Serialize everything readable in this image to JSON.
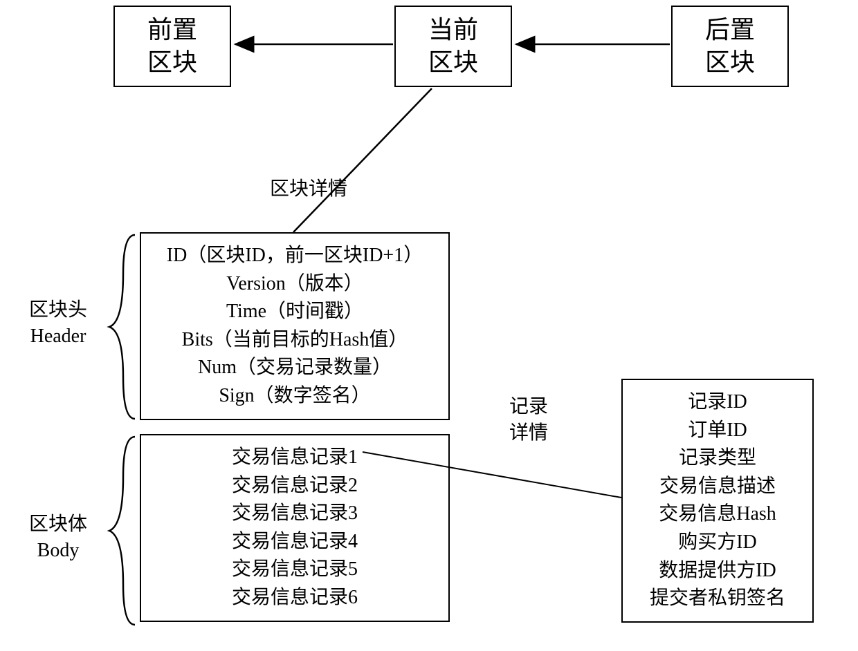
{
  "chain": {
    "prev": {
      "l1": "前置",
      "l2": "区块"
    },
    "curr": {
      "l1": "当前",
      "l2": "区块"
    },
    "next": {
      "l1": "后置",
      "l2": "区块"
    }
  },
  "labels": {
    "block_detail": "区块详情",
    "header_zh": "区块头",
    "header_en": "Header",
    "body_zh": "区块体",
    "body_en": "Body",
    "record_detail_l1": "记录",
    "record_detail_l2": "详情"
  },
  "header_fields": {
    "f1": "ID（区块ID，前一区块ID+1）",
    "f2": "Version（版本）",
    "f3": "Time（时间戳）",
    "f4": "Bits（当前目标的Hash值）",
    "f5": "Num（交易记录数量）",
    "f6": "Sign（数字签名）"
  },
  "body_records": {
    "r1": "交易信息记录1",
    "r2": "交易信息记录2",
    "r3": "交易信息记录3",
    "r4": "交易信息记录4",
    "r5": "交易信息记录5",
    "r6": "交易信息记录6"
  },
  "record_fields": {
    "f1": "记录ID",
    "f2": "订单ID",
    "f3": "记录类型",
    "f4": "交易信息描述",
    "f5": "交易信息Hash",
    "f6": "购买方ID",
    "f7": "数据提供方ID",
    "f8": "提交者私钥签名"
  }
}
